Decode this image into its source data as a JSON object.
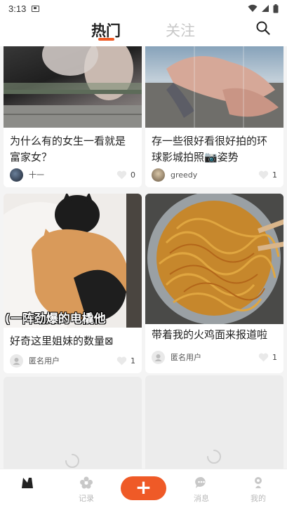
{
  "status_bar": {
    "time": "3:13"
  },
  "header": {
    "tabs": [
      {
        "label": "热门",
        "active": true
      },
      {
        "label": "关注",
        "active": false
      }
    ],
    "search_icon": "search-icon"
  },
  "feed": {
    "cards": [
      {
        "title": "为什么有的女生一看就是富家女？",
        "user": "十一",
        "likes": "0"
      },
      {
        "title": "存一些很好看很好拍的环球影城拍照📷姿势",
        "user": "greedy",
        "likes": "1"
      },
      {
        "title": "好奇这里姐妹的数量⊠",
        "image_caption": "(一阵劲爆的电橇他",
        "user": "匿名用户",
        "likes": "1"
      },
      {
        "title": "带着我的火鸡面来报道啦",
        "user": "匿名用户",
        "likes": "1"
      }
    ]
  },
  "tab_bar": {
    "items": [
      {
        "label": "",
        "icon": "home-icon"
      },
      {
        "label": "记录",
        "icon": "flower-icon"
      },
      {
        "label": "+",
        "icon": "add-icon"
      },
      {
        "label": "消息",
        "icon": "chat-icon"
      },
      {
        "label": "我的",
        "icon": "profile-icon"
      }
    ]
  },
  "colors": {
    "accent": "#f15a24",
    "background": "#f4f4f4"
  }
}
